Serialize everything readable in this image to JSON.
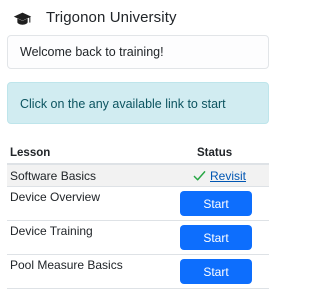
{
  "header": {
    "icon": "graduation-cap-icon",
    "title": "Trigonon University"
  },
  "welcome": {
    "text": "Welcome back to training!"
  },
  "info": {
    "text": "Click on the any available link to start"
  },
  "table": {
    "columns": [
      "Lesson",
      "Status"
    ],
    "rows": [
      {
        "lesson": "Software Basics",
        "status": "completed",
        "status_icon": "check-icon",
        "action_label": "Revisit"
      },
      {
        "lesson": "Device Overview",
        "status": "available",
        "action_label": "Start"
      },
      {
        "lesson": "Device Training",
        "status": "available",
        "action_label": "Start"
      },
      {
        "lesson": "Pool Measure Basics",
        "status": "available",
        "action_label": "Start"
      }
    ]
  },
  "colors": {
    "primary": "#0d6efd",
    "link": "#0056b3",
    "success": "#28a745",
    "info_bg": "#d1ecf1",
    "info_text": "#0c5460"
  }
}
